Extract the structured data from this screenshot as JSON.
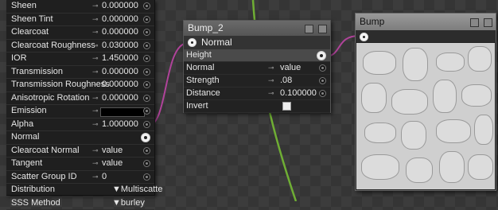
{
  "left_node": {
    "rows": [
      {
        "label": "Sheen",
        "value": "0.000000",
        "kind": "value"
      },
      {
        "label": "Sheen Tint",
        "value": "0.000000",
        "kind": "value"
      },
      {
        "label": "Clearcoat",
        "value": "0.000000",
        "kind": "value"
      },
      {
        "label": "Clearcoat Roughness",
        "value": "0.030000",
        "kind": "value"
      },
      {
        "label": "IOR",
        "value": "1.450000",
        "kind": "value"
      },
      {
        "label": "Transmission",
        "value": "0.000000",
        "kind": "value"
      },
      {
        "label": "Transmission Roughness",
        "value": "0.000000",
        "kind": "value"
      },
      {
        "label": "Anisotropic Rotation",
        "value": "0.000000",
        "kind": "value"
      },
      {
        "label": "Emission",
        "value": "",
        "kind": "color",
        "color": "#000000"
      },
      {
        "label": "Alpha",
        "value": "1.000000",
        "kind": "value"
      },
      {
        "label": "Normal",
        "value": "",
        "kind": "connected"
      },
      {
        "label": "Clearcoat Normal",
        "value": "value",
        "kind": "value"
      },
      {
        "label": "Tangent",
        "value": "value",
        "kind": "value"
      },
      {
        "label": "Scatter Group ID",
        "value": "0",
        "kind": "value"
      },
      {
        "label": "Distribution",
        "value": "Multiscatte",
        "kind": "dropdown"
      },
      {
        "label": "SSS Method",
        "value": "burley",
        "kind": "dropdown"
      }
    ]
  },
  "link_glyph": "⊸",
  "dropdown_glyph": "▼",
  "bump2_node": {
    "title": "Bump_2",
    "output": "Normal",
    "rows": [
      {
        "label": "Height",
        "value": "",
        "kind": "connected"
      },
      {
        "label": "Normal",
        "value": "value",
        "kind": "value"
      },
      {
        "label": "Strength",
        "value": ".08",
        "kind": "value"
      },
      {
        "label": "Distance",
        "value": "0.100000",
        "kind": "value"
      },
      {
        "label": "Invert",
        "value": "",
        "kind": "checkbox"
      }
    ]
  },
  "bump_node": {
    "title": "Bump"
  },
  "colors": {
    "wire_magenta": "#b0439a",
    "wire_green": "#6fae34",
    "node_bg": "#1f1f1f"
  }
}
